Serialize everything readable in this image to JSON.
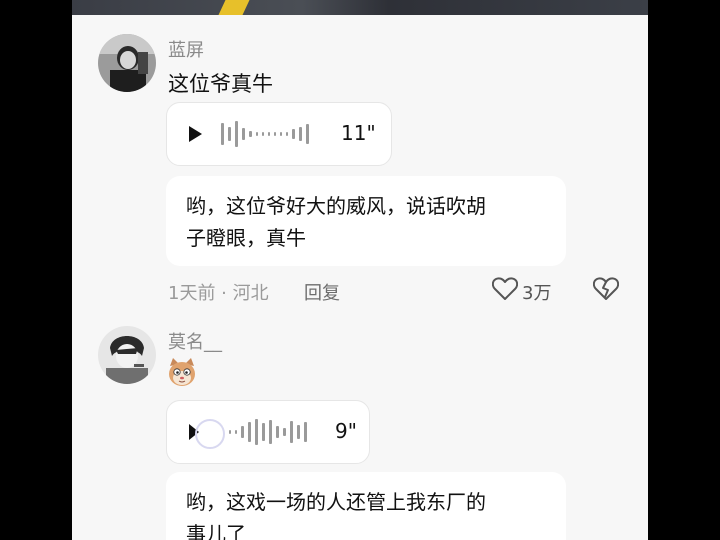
{
  "comments": [
    {
      "username": "蓝屏",
      "text": "这位爷真牛",
      "voice_duration": "11\"",
      "reply_text": "哟，这位爷好大的威风，说话吹胡子瞪眼，真牛",
      "reply_line1": "哟，这位爷好大的威风，说话吹胡",
      "reply_line2": "子瞪眼，真牛",
      "time": "1天前 · 河北",
      "reply_label": "回复",
      "like_count": "3万",
      "icons": {
        "like": "heart-outline-icon",
        "dislike": "broken-heart-icon",
        "play": "play-icon"
      }
    },
    {
      "username": "莫名__",
      "emoji": "cat-face-emoji",
      "voice_duration": "9\"",
      "reply_line1": "哟，这戏一场的人还管上我东厂的",
      "reply_line2": "事儿了"
    }
  ],
  "colors": {
    "panel_bg": "#f7f7f7",
    "bubble_bg": "#ffffff",
    "username": "#8a8a8a",
    "meta": "#9a9a9a"
  }
}
